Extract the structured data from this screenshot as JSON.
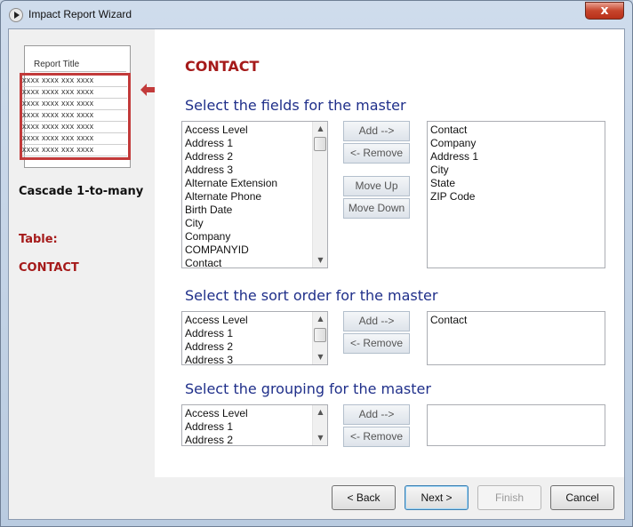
{
  "window": {
    "title": "Impact Report Wizard",
    "close_glyph": "x"
  },
  "sidebar": {
    "preview_title": "Report Title",
    "preview_rows": [
      "xxxx  xxxx  xxx  xxxx",
      "xxxx  xxxx  xxx  xxxx",
      "xxxx  xxxx  xxx  xxxx",
      "xxxx  xxxx  xxx  xxxx",
      "xxxx  xxxx  xxx  xxxx",
      "xxxx  xxxx  xxx  xxxx",
      "xxxx  xxxx  xxx  xxxx"
    ],
    "relationship": "Cascade 1-to-many",
    "table_label": "Table:",
    "table_name": "CONTACT"
  },
  "main": {
    "section_title": "CONTACT",
    "fields": {
      "heading": "Select the fields for the master",
      "available": [
        "Access Level",
        "Address 1",
        "Address 2",
        "Address 3",
        "Alternate Extension",
        "Alternate Phone",
        "Birth Date",
        "City",
        "Company",
        "COMPANYID",
        "Contact"
      ],
      "selected": [
        "Contact",
        "Company",
        "Address 1",
        "City",
        "State",
        "ZIP Code"
      ],
      "add_label": "Add -->",
      "remove_label": "<- Remove",
      "move_up_label": "Move Up",
      "move_down_label": "Move Down"
    },
    "sort": {
      "heading": "Select the sort order for the master",
      "available": [
        "Access Level",
        "Address 1",
        "Address 2",
        "Address 3"
      ],
      "selected": [
        "Contact"
      ],
      "add_label": "Add -->",
      "remove_label": "<- Remove"
    },
    "grouping": {
      "heading": "Select the grouping for the master",
      "available": [
        "Access Level",
        "Address 1",
        "Address 2"
      ],
      "selected": [],
      "add_label": "Add -->",
      "remove_label": "<- Remove"
    }
  },
  "footer": {
    "back_label": "< Back",
    "next_label": "Next >",
    "finish_label": "Finish",
    "cancel_label": "Cancel"
  },
  "icons": {
    "scroll_up": "▲",
    "scroll_down": "▼"
  },
  "colors": {
    "accent_red": "#a51a1a",
    "heading_blue": "#1f2f8a",
    "highlight_red": "#c23a3a"
  }
}
